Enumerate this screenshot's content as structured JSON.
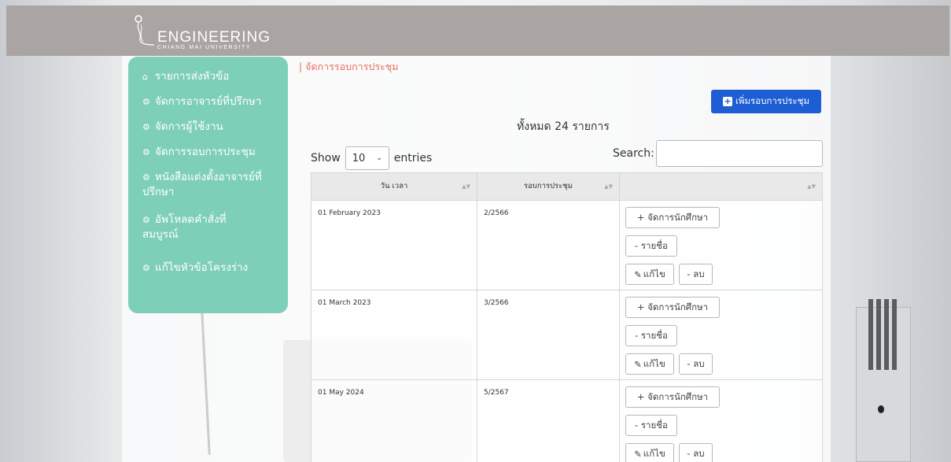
{
  "header": {
    "logo_title": "ENGINEERING",
    "logo_subtitle": "CHIANG MAI UNIVERSITY"
  },
  "sidebar": {
    "items": [
      {
        "label": "รายการส่งหัวข้อ",
        "icon": "home-icon"
      },
      {
        "label": "จัดการอาจารย์ที่ปรึกษา",
        "icon": "gear-icon"
      },
      {
        "label": "จัดการผู้ใช้งาน",
        "icon": "gear-icon"
      },
      {
        "label": "จัดการรอบการประชุม",
        "icon": "gear-icon"
      },
      {
        "label": "หนังสือแต่งตั้งอาจารย์ที่ปรึกษา",
        "icon": "gear-icon"
      },
      {
        "label": "อัพโหลดคำสั่งที่สมบูรณ์",
        "icon": "gear-icon"
      },
      {
        "label": "แก้ไขหัวข้อโครงร่าง",
        "icon": "gear-icon"
      }
    ]
  },
  "main": {
    "breadcrumb": "| จัดการรอบการประชุม",
    "add_button": "เพิ่มรอบการประชุม",
    "total": "ทั้งหมด 24 รายการ",
    "show_label": "Show",
    "entries_value": "10",
    "entries_label": "entries",
    "search_label": "Search:",
    "columns": [
      "วัน เวลา",
      "รอบการประชุม",
      ""
    ],
    "rows": [
      {
        "date": "01 February 2023",
        "round": "2/2566"
      },
      {
        "date": "01 March 2023",
        "round": "3/2566"
      },
      {
        "date": "01 May 2024",
        "round": "5/2567"
      }
    ],
    "row_buttons": {
      "manage_students": "+ จัดการนักศึกษา",
      "name_list": "- รายชื่อ",
      "edit": "แก้ไข",
      "delete": "- ลบ"
    }
  },
  "colors": {
    "sidebar": "#7ecfb7",
    "topbar": "#aaa4a2",
    "primary": "#1d5ed4",
    "breadcrumb": "#e8715f"
  }
}
